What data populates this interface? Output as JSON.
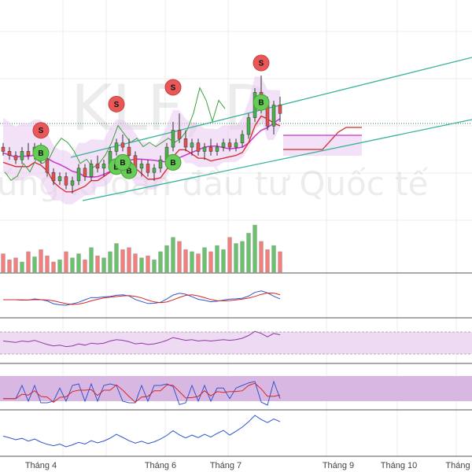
{
  "watermark": {
    "symbol": "KLF, D",
    "caption": "Chứng khoán đầu tư Quốc tế"
  },
  "colors": {
    "up": "#4caf50",
    "down": "#e05252",
    "volume_up": "#6cc070",
    "volume_down": "#f08080",
    "cloud_band": "#e8c8f0",
    "kijun": "#cc33cc",
    "tenkan": "#d62728",
    "chikou": "#3ca03c",
    "channel": "#39b39b",
    "indicator_fill": "#eedaf2",
    "stoch_fill": "#d8b8e2",
    "grid": "#ececec"
  },
  "chart_data": [
    {
      "type": "candlestick",
      "panel": "price",
      "watermark": "KLF, D",
      "x_ticks": [
        "Tháng 4",
        "Tháng 6",
        "Tháng 7",
        "Tháng 9",
        "Tháng 10",
        "Tháng"
      ],
      "signals": [
        {
          "label": "S",
          "kind": "sell",
          "bar": 6
        },
        {
          "label": "B",
          "kind": "buy",
          "bar": 6
        },
        {
          "label": "B",
          "kind": "buy",
          "bar": 18
        },
        {
          "label": "S",
          "kind": "sell",
          "bar": 18
        },
        {
          "label": "B",
          "kind": "buy",
          "bar": 20
        },
        {
          "label": "B",
          "kind": "buy",
          "bar": 19
        },
        {
          "label": "B",
          "kind": "buy",
          "bar": 27
        },
        {
          "label": "S",
          "kind": "sell",
          "bar": 27
        },
        {
          "label": "S",
          "kind": "sell",
          "bar": 41
        },
        {
          "label": "B",
          "kind": "buy",
          "bar": 41
        }
      ],
      "candles": [
        [
          3.9,
          3.95,
          3.8,
          3.85
        ],
        [
          3.85,
          3.9,
          3.75,
          3.8
        ],
        [
          3.8,
          3.85,
          3.7,
          3.75
        ],
        [
          3.75,
          3.9,
          3.7,
          3.85
        ],
        [
          3.85,
          3.95,
          3.75,
          3.8
        ],
        [
          3.8,
          3.95,
          3.75,
          3.9
        ],
        [
          3.9,
          3.95,
          3.7,
          3.75
        ],
        [
          3.75,
          3.8,
          3.55,
          3.6
        ],
        [
          3.6,
          3.65,
          3.45,
          3.5
        ],
        [
          3.5,
          3.6,
          3.45,
          3.55
        ],
        [
          3.55,
          3.6,
          3.4,
          3.45
        ],
        [
          3.45,
          3.55,
          3.35,
          3.5
        ],
        [
          3.5,
          3.7,
          3.45,
          3.65
        ],
        [
          3.65,
          3.7,
          3.5,
          3.55
        ],
        [
          3.55,
          3.75,
          3.5,
          3.7
        ],
        [
          3.7,
          3.8,
          3.6,
          3.65
        ],
        [
          3.65,
          3.75,
          3.55,
          3.7
        ],
        [
          3.7,
          3.9,
          3.65,
          3.85
        ],
        [
          3.85,
          4.0,
          3.8,
          3.95
        ],
        [
          3.95,
          4.05,
          3.85,
          3.9
        ],
        [
          3.9,
          4.0,
          3.75,
          3.8
        ],
        [
          3.8,
          3.85,
          3.6,
          3.65
        ],
        [
          3.65,
          3.75,
          3.55,
          3.7
        ],
        [
          3.7,
          3.75,
          3.55,
          3.6
        ],
        [
          3.6,
          3.7,
          3.5,
          3.65
        ],
        [
          3.65,
          3.8,
          3.6,
          3.75
        ],
        [
          3.75,
          3.95,
          3.7,
          3.9
        ],
        [
          3.9,
          4.2,
          3.85,
          4.1
        ],
        [
          4.1,
          4.3,
          3.95,
          4.0
        ],
        [
          4.0,
          4.1,
          3.85,
          3.9
        ],
        [
          3.9,
          4.0,
          3.8,
          3.95
        ],
        [
          3.95,
          4.0,
          3.8,
          3.85
        ],
        [
          3.85,
          3.95,
          3.75,
          3.9
        ],
        [
          3.9,
          4.0,
          3.8,
          3.85
        ],
        [
          3.85,
          3.95,
          3.8,
          3.9
        ],
        [
          3.9,
          4.0,
          3.85,
          3.95
        ],
        [
          3.95,
          4.0,
          3.85,
          3.9
        ],
        [
          3.9,
          4.0,
          3.85,
          3.95
        ],
        [
          3.95,
          4.1,
          3.9,
          4.05
        ],
        [
          4.05,
          4.3,
          4.0,
          4.25
        ],
        [
          4.25,
          4.6,
          4.2,
          4.55
        ],
        [
          4.55,
          4.75,
          4.3,
          4.4
        ],
        [
          4.4,
          4.5,
          4.1,
          4.15
        ],
        [
          4.15,
          4.45,
          4.05,
          4.4
        ],
        [
          4.4,
          4.5,
          4.2,
          4.3
        ]
      ],
      "volume": [
        18,
        12,
        14,
        10,
        20,
        15,
        22,
        16,
        10,
        12,
        20,
        14,
        18,
        12,
        24,
        16,
        14,
        20,
        28,
        22,
        24,
        18,
        14,
        16,
        12,
        20,
        26,
        34,
        30,
        22,
        20,
        18,
        24,
        20,
        26,
        22,
        34,
        28,
        30,
        38,
        46,
        30,
        22,
        26,
        20
      ]
    },
    {
      "type": "line",
      "panel": "macd",
      "series": [
        "macd",
        "signal"
      ]
    },
    {
      "type": "area",
      "panel": "rsi",
      "series": [
        "rsi"
      ]
    },
    {
      "type": "area",
      "panel": "stochastic",
      "series": [
        "k",
        "d"
      ]
    },
    {
      "type": "line",
      "panel": "obv",
      "series": [
        "obv"
      ]
    }
  ]
}
